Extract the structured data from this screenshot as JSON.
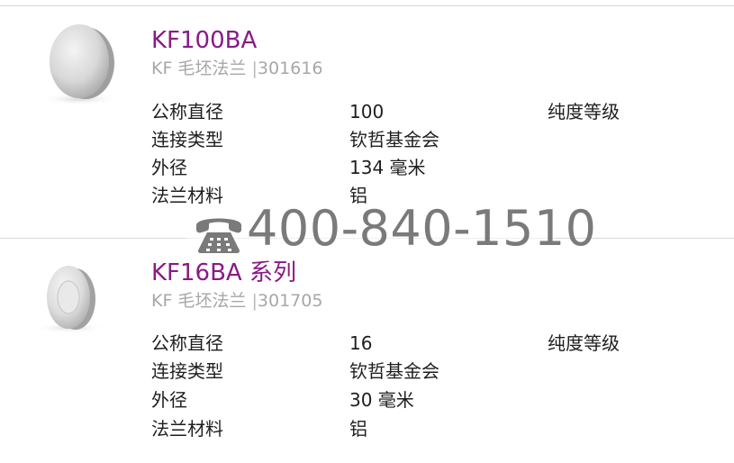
{
  "products": [
    {
      "title": "KF100BA",
      "category": "KF 毛坯法兰",
      "separator": "|",
      "part_number": "301616",
      "specs": {
        "nominal_diameter_label": "公称直径",
        "nominal_diameter_value": "100",
        "purity_label": "纯度等级",
        "connection_type_label": "连接类型",
        "connection_type_value": "钦哲基金会",
        "outer_diameter_label": "外径",
        "outer_diameter_value": "134 毫米",
        "flange_material_label": "法兰材料",
        "flange_material_value": "铝"
      }
    },
    {
      "title": "KF16BA 系列",
      "category": "KF 毛坯法兰",
      "separator": "|",
      "part_number": "301705",
      "specs": {
        "nominal_diameter_label": "公称直径",
        "nominal_diameter_value": "16",
        "purity_label": "纯度等级",
        "connection_type_label": "连接类型",
        "connection_type_value": "钦哲基金会",
        "outer_diameter_label": "外径",
        "outer_diameter_value": "30 毫米",
        "flange_material_label": "法兰材料",
        "flange_material_value": "铝"
      }
    }
  ],
  "watermark": {
    "icon": "telephone-icon",
    "phone": "400-840-1510"
  },
  "colors": {
    "title": "#8a1a86",
    "subtitle": "#a7a7a7",
    "text": "#1e1e1e",
    "watermark": "#7a7a7a",
    "divider": "#d9d9d9"
  }
}
